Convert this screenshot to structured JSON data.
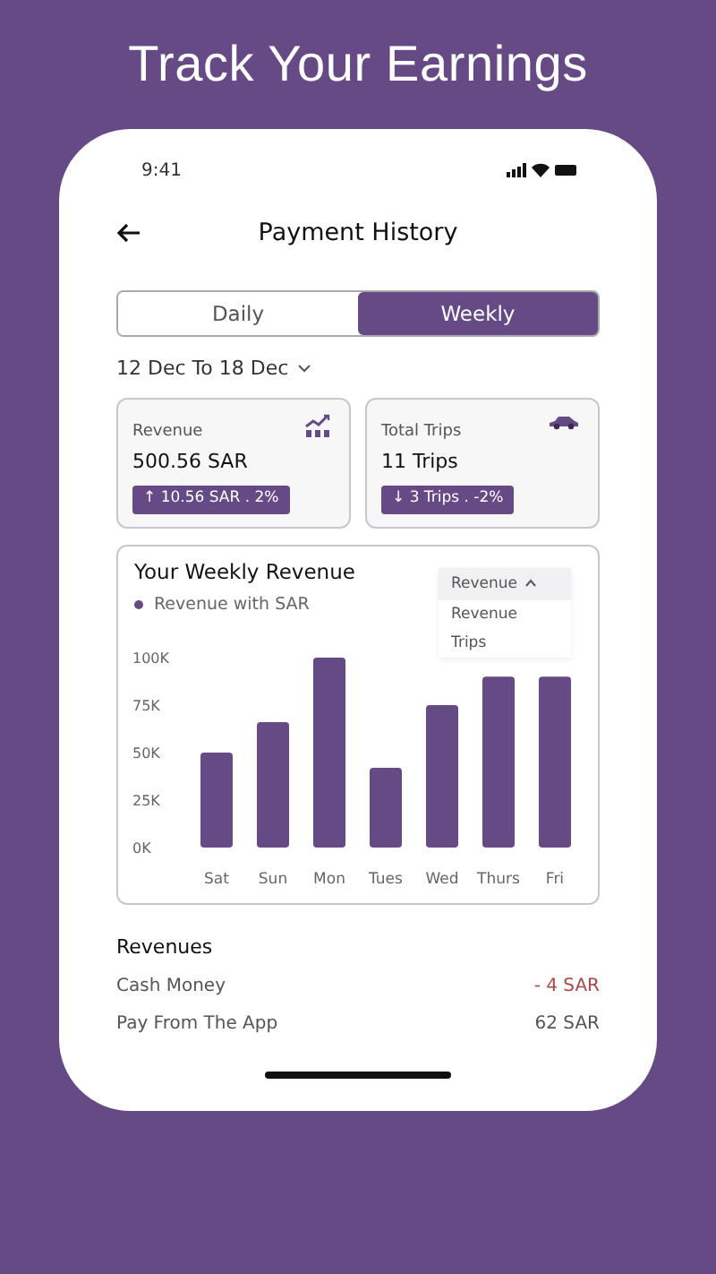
{
  "headline": "Track Your Earnings",
  "status_bar": {
    "time": "9:41"
  },
  "header": {
    "title": "Payment History"
  },
  "tabs": [
    {
      "label": "Daily",
      "selected": false
    },
    {
      "label": "Weekly",
      "selected": true
    }
  ],
  "date_range": {
    "label": "12 Dec To  18 Dec"
  },
  "stats": [
    {
      "kind": "revenue",
      "label": "Revenue",
      "value": "500.56 SAR",
      "change": "↑ 10.56 SAR . 2%"
    },
    {
      "kind": "trips",
      "label": "Total Trips",
      "value": "11 Trips",
      "change": "↓ 3 Trips . -2%"
    }
  ],
  "chart_card": {
    "title": "Your Weekly Revenue",
    "dropdown": {
      "value": "Revenue",
      "expanded": true,
      "options": [
        "Revenue",
        "Trips"
      ]
    },
    "chart_data": {
      "type": "bar",
      "categories": [
        "Sat",
        "Sun",
        "Mon",
        "Tues",
        "Wed",
        "Thurs",
        "Fri"
      ],
      "series": [
        {
          "name": "Revenue with SAR",
          "color": "#654a86",
          "values": [
            50000,
            66000,
            100000,
            42000,
            75000,
            90000,
            90000
          ]
        }
      ],
      "ylim": [
        0,
        100000
      ],
      "yticks": [
        {
          "value": 0,
          "label": "0K"
        },
        {
          "value": 25000,
          "label": "25K"
        },
        {
          "value": 50000,
          "label": "50K"
        },
        {
          "value": 75000,
          "label": "75K"
        },
        {
          "value": 100000,
          "label": "100K"
        }
      ]
    }
  },
  "revenues": {
    "title": "Revenues",
    "rows": [
      {
        "label": "Cash Money",
        "amount": "- 4 SAR",
        "negative": true
      },
      {
        "label": "Pay From The App",
        "amount": "62 SAR",
        "negative": false
      }
    ]
  }
}
